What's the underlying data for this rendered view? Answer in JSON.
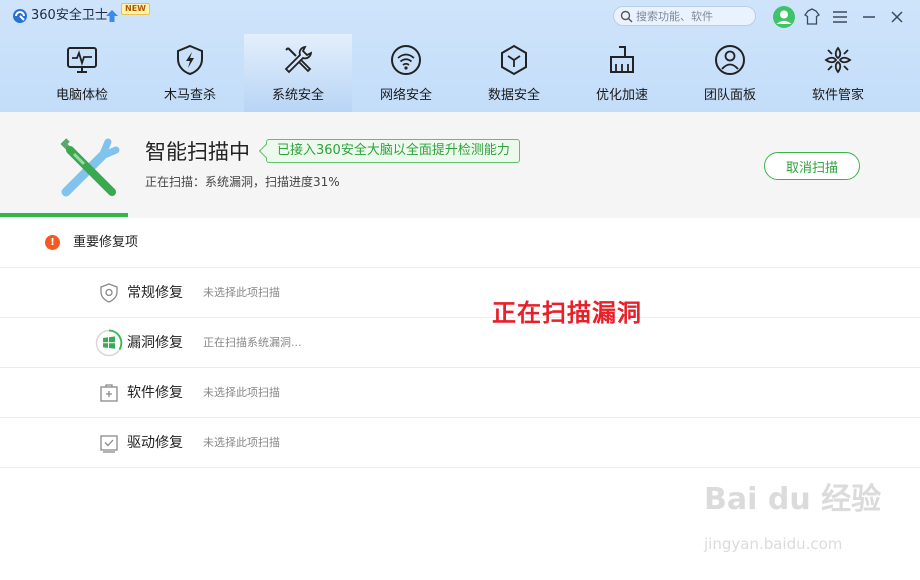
{
  "app": {
    "title": "360安全卫士",
    "new_badge": "NEW"
  },
  "search": {
    "placeholder": "搜索功能、软件"
  },
  "nav": {
    "items": [
      {
        "label": "电脑体检",
        "icon": "monitor-pulse-icon"
      },
      {
        "label": "木马查杀",
        "icon": "shield-bolt-icon"
      },
      {
        "label": "系统安全",
        "icon": "wrench-screwdriver-icon",
        "active": true
      },
      {
        "label": "网络安全",
        "icon": "wifi-icon"
      },
      {
        "label": "数据安全",
        "icon": "hexagon-cube-icon"
      },
      {
        "label": "优化加速",
        "icon": "broom-icon"
      },
      {
        "label": "团队面板",
        "icon": "team-person-icon"
      },
      {
        "label": "软件管家",
        "icon": "app-grid-icon"
      }
    ]
  },
  "scan": {
    "title": "智能扫描中",
    "badge": "已接入360安全大脑以全面提升检测能力",
    "status": "正在扫描：系统漏洞，扫描进度31%",
    "progress": 0.31,
    "cancel_label": "取消扫描"
  },
  "group": {
    "title": "重要修复项",
    "warn_glyph": "!"
  },
  "rows": [
    {
      "name": "常规修复",
      "status": "未选择此项扫描",
      "icon": "shield-outline-icon"
    },
    {
      "name": "漏洞修复",
      "status": "正在扫描系统漏洞...",
      "icon": "windows-logo-icon"
    },
    {
      "name": "软件修复",
      "status": "未选择此项扫描",
      "icon": "software-box-icon"
    },
    {
      "name": "驱动修复",
      "status": "未选择此项扫描",
      "icon": "driver-check-icon"
    }
  ],
  "annotation": "正在扫描漏洞",
  "watermark": {
    "brand": "Bai du 经验",
    "url": "jingyan.baidu.com"
  },
  "colors": {
    "header_bg": "#c3ddf9",
    "accent_green": "#2fb845",
    "warning_orange": "#f05a24",
    "annotation_red": "#e8202a"
  }
}
